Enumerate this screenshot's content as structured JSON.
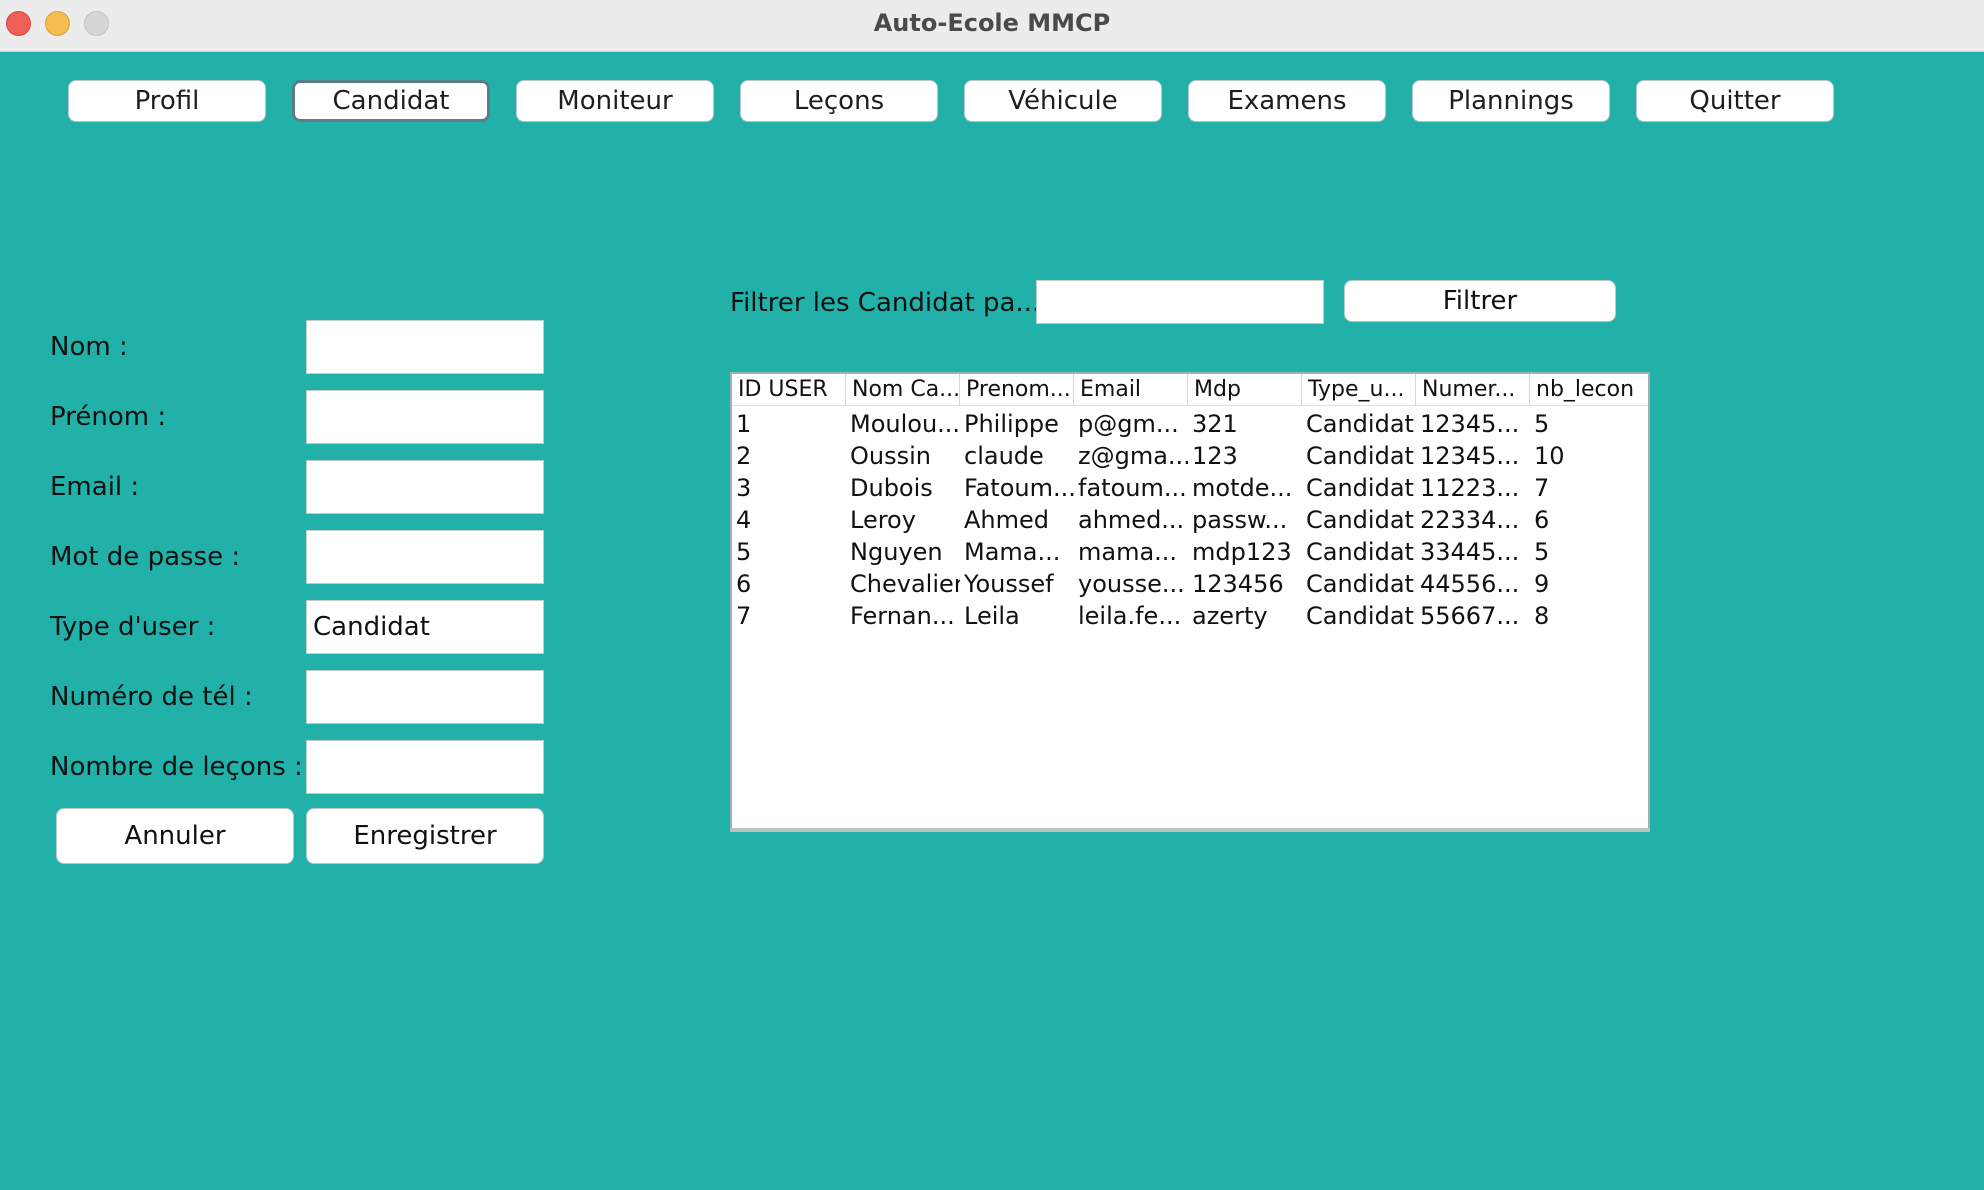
{
  "window": {
    "title": "Auto-Ecole MMCP"
  },
  "nav": {
    "items": [
      {
        "label": "Profil"
      },
      {
        "label": "Candidat",
        "active": true
      },
      {
        "label": "Moniteur"
      },
      {
        "label": "Leçons"
      },
      {
        "label": "Véhicule"
      },
      {
        "label": "Examens"
      },
      {
        "label": "Plannings"
      },
      {
        "label": "Quitter"
      }
    ]
  },
  "form": {
    "fields": [
      {
        "label": "Nom :",
        "value": ""
      },
      {
        "label": "Prénom :",
        "value": ""
      },
      {
        "label": "Email :",
        "value": ""
      },
      {
        "label": "Mot de passe :",
        "value": ""
      },
      {
        "label": "Type d'user :",
        "value": "Candidat"
      },
      {
        "label": "Numéro de tél :",
        "value": ""
      },
      {
        "label": "Nombre de leçons :",
        "value": ""
      }
    ],
    "cancel_label": "Annuler",
    "save_label": "Enregistrer"
  },
  "filter": {
    "label": "Filtrer les Candidat pa...",
    "value": "",
    "button_label": "Filtrer"
  },
  "table": {
    "columns": [
      "ID USER",
      "Nom Ca...",
      "Prenom...",
      "Email",
      "Mdp",
      "Type_u...",
      "Numer...",
      "nb_lecon"
    ],
    "rows": [
      [
        "1",
        "Moulou...",
        "Philippe",
        "p@gm...",
        "321",
        "Candidat",
        "12345...",
        "5"
      ],
      [
        "2",
        "Oussin",
        "claude",
        "z@gma...",
        "123",
        "Candidat",
        "12345...",
        "10"
      ],
      [
        "3",
        "Dubois",
        "Fatoum...",
        "fatoum...",
        "motde...",
        "Candidat",
        "11223...",
        "7"
      ],
      [
        "4",
        "Leroy",
        "Ahmed",
        "ahmed...",
        "passw...",
        "Candidat",
        "22334...",
        "6"
      ],
      [
        "5",
        "Nguyen",
        "Mama...",
        "mama...",
        "mdp123",
        "Candidat",
        "33445...",
        "5"
      ],
      [
        "6",
        "Chevalier",
        "Youssef",
        "yousse...",
        "123456",
        "Candidat",
        "44556...",
        "9"
      ],
      [
        "7",
        "Fernan...",
        "Leila",
        "leila.fe...",
        "azerty",
        "Candidat",
        "55667...",
        "8"
      ]
    ]
  },
  "colors": {
    "background": "#21b1a9",
    "titlebar": "#ececec",
    "close": "#ee5f57",
    "minimize": "#f5bd4f",
    "maximize": "#d6d6d6"
  }
}
